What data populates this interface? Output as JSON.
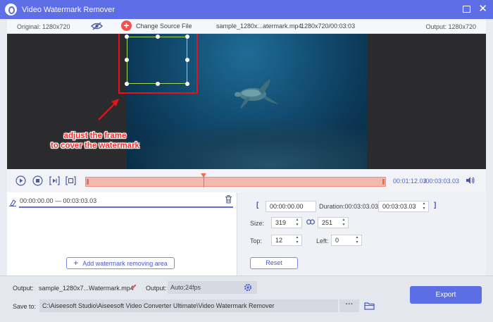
{
  "window": {
    "title": "Video Watermark Remover",
    "maximize_icon": "maximize-icon",
    "close_label": "✕"
  },
  "infobar": {
    "original": "Original: 1280x720",
    "change_source": "Change Source File",
    "filename": "sample_1280x...atermark.mp4",
    "fileinfo": "1280x720/00:03:03",
    "output": "Output: 1280x720"
  },
  "annotation": {
    "line1": "adjust the frame",
    "line2": "to cover the watermark"
  },
  "playback": {
    "current_time": "00:01:12.03",
    "total_time": "/00:03:03.03",
    "progress_fraction": 0.392
  },
  "segments": [
    {
      "range": "00:00:00.00 — 00:03:03.03"
    }
  ],
  "add_area_label": "Add watermark removing area",
  "settings": {
    "start": "00:00:00.00",
    "duration_label": "Duration:00:03:03.03",
    "end": "00:03:03.03",
    "size_label": "Size:",
    "width": "319",
    "height": "251",
    "top_label": "Top:",
    "top": "12",
    "left_label": "Left:",
    "left": "0",
    "reset_label": "Reset"
  },
  "bottom": {
    "output_label": "Output:",
    "output_file": "sample_1280x7...Watermark.mp4",
    "output_fmt_label": "Output:",
    "output_fmt": "Auto;24fps",
    "save_label": "Save to:",
    "save_path": "C:\\Aiseesoft Studio\\Aiseesoft Video Converter Ultimate\\Video Watermark Remover",
    "more_label": "···",
    "export_label": "Export"
  },
  "colors": {
    "accent": "#5e6ee6",
    "timeline": "#f3b8ae",
    "playhead": "#f06a54",
    "annotation": "#ff2b2b"
  }
}
